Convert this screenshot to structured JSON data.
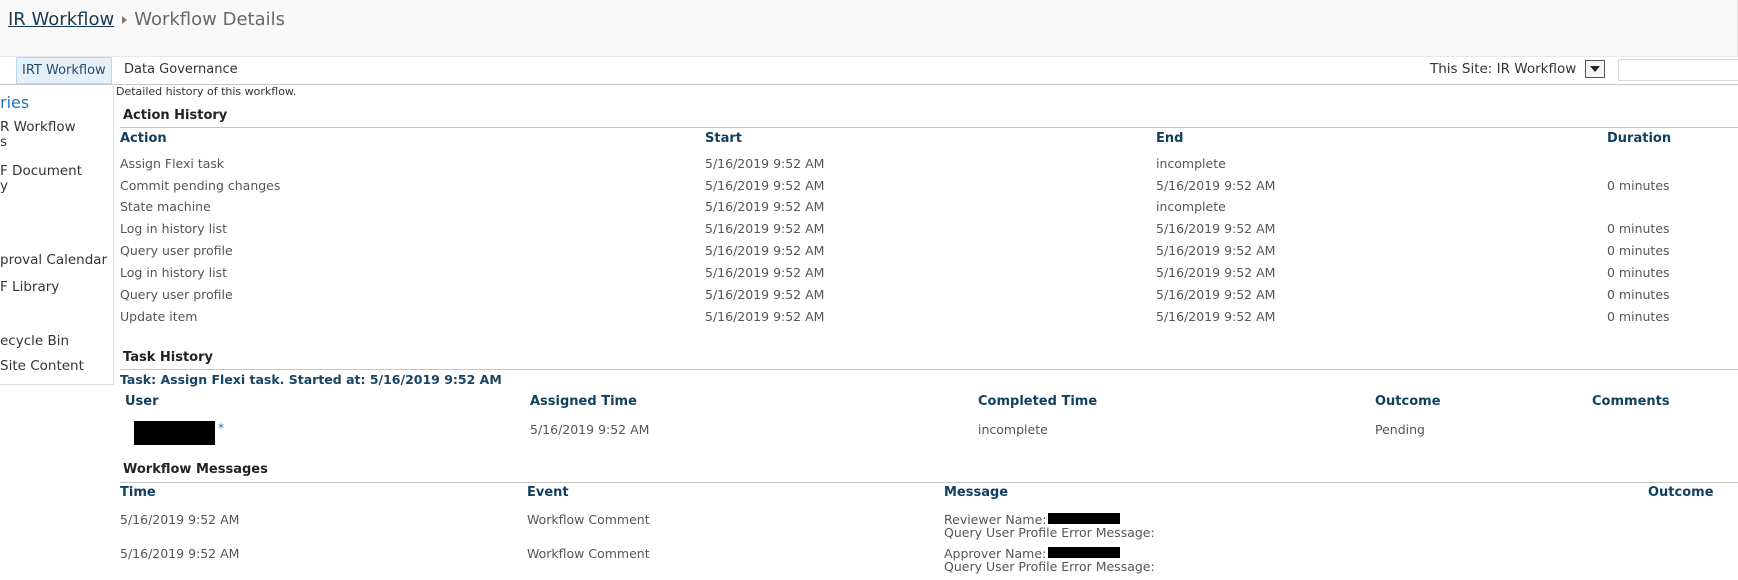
{
  "breadcrumb": {
    "parent": "IR Workflow",
    "current": "Workflow Details"
  },
  "tabs": [
    {
      "label": "IRT Workflow",
      "selected": true
    },
    {
      "label": "Data Governance",
      "selected": false
    }
  ],
  "search": {
    "scope_label": "This Site: IR Workflow"
  },
  "leftnav": {
    "heading": "ries",
    "items": [
      "R Workflow",
      "s",
      "F Document",
      "y",
      "proval Calendar",
      "F Library",
      "ecycle Bin",
      " Site Content"
    ]
  },
  "page": {
    "description": "Detailed history of this workflow."
  },
  "action_history": {
    "title": "Action History",
    "columns": [
      "Action",
      "Start",
      "End",
      "Duration"
    ],
    "rows": [
      [
        "Assign Flexi task",
        "5/16/2019 9:52 AM",
        "incomplete",
        ""
      ],
      [
        "Commit pending changes",
        "5/16/2019 9:52 AM",
        "5/16/2019 9:52 AM",
        "0 minutes"
      ],
      [
        "State machine",
        "5/16/2019 9:52 AM",
        "incomplete",
        ""
      ],
      [
        "Log in history list",
        "5/16/2019 9:52 AM",
        "5/16/2019 9:52 AM",
        "0 minutes"
      ],
      [
        "Query user profile",
        "5/16/2019 9:52 AM",
        "5/16/2019 9:52 AM",
        "0 minutes"
      ],
      [
        "Log in history list",
        "5/16/2019 9:52 AM",
        "5/16/2019 9:52 AM",
        "0 minutes"
      ],
      [
        "Query user profile",
        "5/16/2019 9:52 AM",
        "5/16/2019 9:52 AM",
        "0 minutes"
      ],
      [
        "Update item",
        "5/16/2019 9:52 AM",
        "5/16/2019 9:52 AM",
        "0 minutes"
      ]
    ]
  },
  "task_history": {
    "title": "Task History",
    "task_title": "Task: Assign Flexi task. Started at: 5/16/2019 9:52 AM",
    "columns": [
      "User",
      "Assigned Time",
      "Completed Time",
      "Outcome",
      "Comments"
    ],
    "rows": [
      {
        "user_marker": "*",
        "assigned": "5/16/2019 9:52 AM",
        "completed": "incomplete",
        "outcome": "Pending",
        "comments": ""
      }
    ]
  },
  "workflow_messages": {
    "title": "Workflow Messages",
    "columns": [
      "Time",
      "Event",
      "Message",
      "Outcome"
    ],
    "rows": [
      {
        "time": "5/16/2019 9:52 AM",
        "event": "Workflow Comment",
        "line1": "Reviewer Name:",
        "line2": "Query User Profile Error Message:"
      },
      {
        "time": "5/16/2019 9:52 AM",
        "event": "Workflow Comment",
        "line1": "Approver Name:",
        "line2": "Query User Profile Error Message:"
      }
    ]
  },
  "colors": {
    "link": "#2477b5",
    "header_text": "#123f5e",
    "tab_selected_bg": "#e4f0fa"
  }
}
